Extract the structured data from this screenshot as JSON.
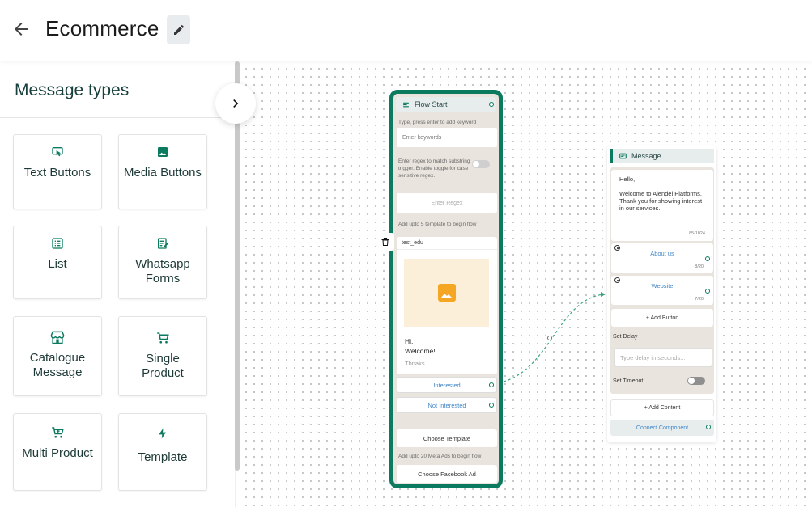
{
  "header": {
    "title": "Ecommerce"
  },
  "sidebar": {
    "title": "Message types",
    "tiles": [
      {
        "label": "Text Buttons",
        "icon": "text-buttons-icon"
      },
      {
        "label": "Media Buttons",
        "icon": "image-icon"
      },
      {
        "label": "List",
        "icon": "list-icon"
      },
      {
        "label": "Whatsapp Forms",
        "icon": "form-icon"
      },
      {
        "label": "Catalogue Message",
        "icon": "store-icon"
      },
      {
        "label": "Single Product",
        "icon": "cart-icon"
      },
      {
        "label": "Multi Product",
        "icon": "cart-plus-icon"
      },
      {
        "label": "Template",
        "icon": "bolt-icon"
      }
    ]
  },
  "flow_start": {
    "title": "Flow Start",
    "keyword_hint": "Type, press enter to add keyword",
    "keyword_placeholder": "Enter keywords",
    "regex_hint": "Enter regex to match substring trigger. Enable toggle for case sensitive regex.",
    "regex_placeholder": "Enter Regex",
    "template_hint": "Add upto 5 template to begin flow",
    "template": {
      "name": "test_edu",
      "greeting": "Hi,",
      "body": "Welcome!",
      "footer": "Thnaks",
      "buttons": [
        "Interested",
        "Not Interested"
      ]
    },
    "choose_template_label": "Choose Template",
    "meta_ads_hint": "Add upto 20 Meta Ads to begin flow",
    "choose_facebook_ad_label": "Choose Facebook Ad"
  },
  "message_node": {
    "title": "Message",
    "text_lines": [
      "Hello,",
      "",
      "Welcome to Alendei Platforms. Thank you for showing interest in our services."
    ],
    "text_count": "85/1024",
    "buttons": [
      {
        "label": "About us",
        "count": "8/20"
      },
      {
        "label": "Website",
        "count": "7/20"
      }
    ],
    "add_button_label": "+ Add Button",
    "set_delay_label": "Set Delay",
    "delay_placeholder": "Type delay in seconds...",
    "set_timeout_label": "Set Timeout",
    "add_content_label": "+ Add Content",
    "connect_component_label": "Connect Component"
  },
  "colors": {
    "accent": "#0b7a5f",
    "link": "#3f86c9",
    "node_bg": "#e9e4dd",
    "media_icon": "#f5a623"
  }
}
